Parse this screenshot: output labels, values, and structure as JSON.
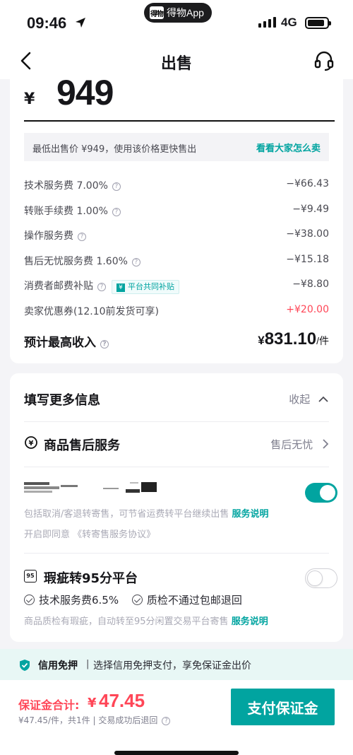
{
  "status_bar": {
    "time": "09:46",
    "network": "4G",
    "app_name": "得物App",
    "app_logo": "得物",
    "battery_level": 0.9
  },
  "nav": {
    "title": "出售",
    "back_icon": "chevron-left-icon",
    "service_icon": "headset-icon"
  },
  "price": {
    "currency": "¥",
    "value": "949"
  },
  "tip": {
    "text": "最低出售价 ¥949，使用该价格更快售出",
    "link": "看看大家怎么卖"
  },
  "fees": [
    {
      "label": "技术服务费 7.00%",
      "value": "−¥66.43",
      "help": true
    },
    {
      "label": "转账手续费 1.00%",
      "value": "−¥9.49",
      "help": true
    },
    {
      "label": "操作服务费",
      "value": "−¥38.00",
      "help": true
    },
    {
      "label": "售后无忧服务费 1.60%",
      "value": "−¥15.18",
      "help": true
    },
    {
      "label": "消费者邮费补贴",
      "value": "−¥8.80",
      "help": true,
      "badge": "平台共同补贴",
      "badge_icon": "¥"
    },
    {
      "label": "卖家优惠券(12.10前发货可享)",
      "value": "+¥20.00",
      "help": false,
      "positive": true
    }
  ],
  "total": {
    "label": "预计最高收入",
    "currency": "¥",
    "value": "831.10",
    "unit": "/件"
  },
  "more_info": {
    "title": "填写更多信息",
    "toggle_label": "收起"
  },
  "after_sale": {
    "title": "商品售后服务",
    "right_label": "售后无忧",
    "desc": "包括取消/客退转寄售，可节省运费转平台继续出售",
    "desc_link": "服务说明",
    "agree_prefix": "开启即同意",
    "agree_doc": "《转寄售服务协议》",
    "toggle_on": true
  },
  "flaw": {
    "title": "瑕疵转95分平台",
    "icon_text": "95",
    "checks": [
      "技术服务费6.5%",
      "质检不通过包邮退回"
    ],
    "desc": "商品质检有瑕疵，自动转至95分闲置交易平台寄售",
    "desc_link": "服务说明",
    "toggle_on": false
  },
  "notice": {
    "title": "信用免押",
    "sep": "|",
    "text": "选择信用免押支付，享免保证金出价"
  },
  "footer": {
    "deposit_label": "保证金合计:",
    "deposit_currency": "¥",
    "deposit_value": "47.45",
    "sub": "¥47.45/件，共1件 | 交易成功后退回",
    "pay_button": "支付保证金"
  },
  "colors": {
    "accent": "#01a4a0",
    "red": "#ff4657"
  }
}
